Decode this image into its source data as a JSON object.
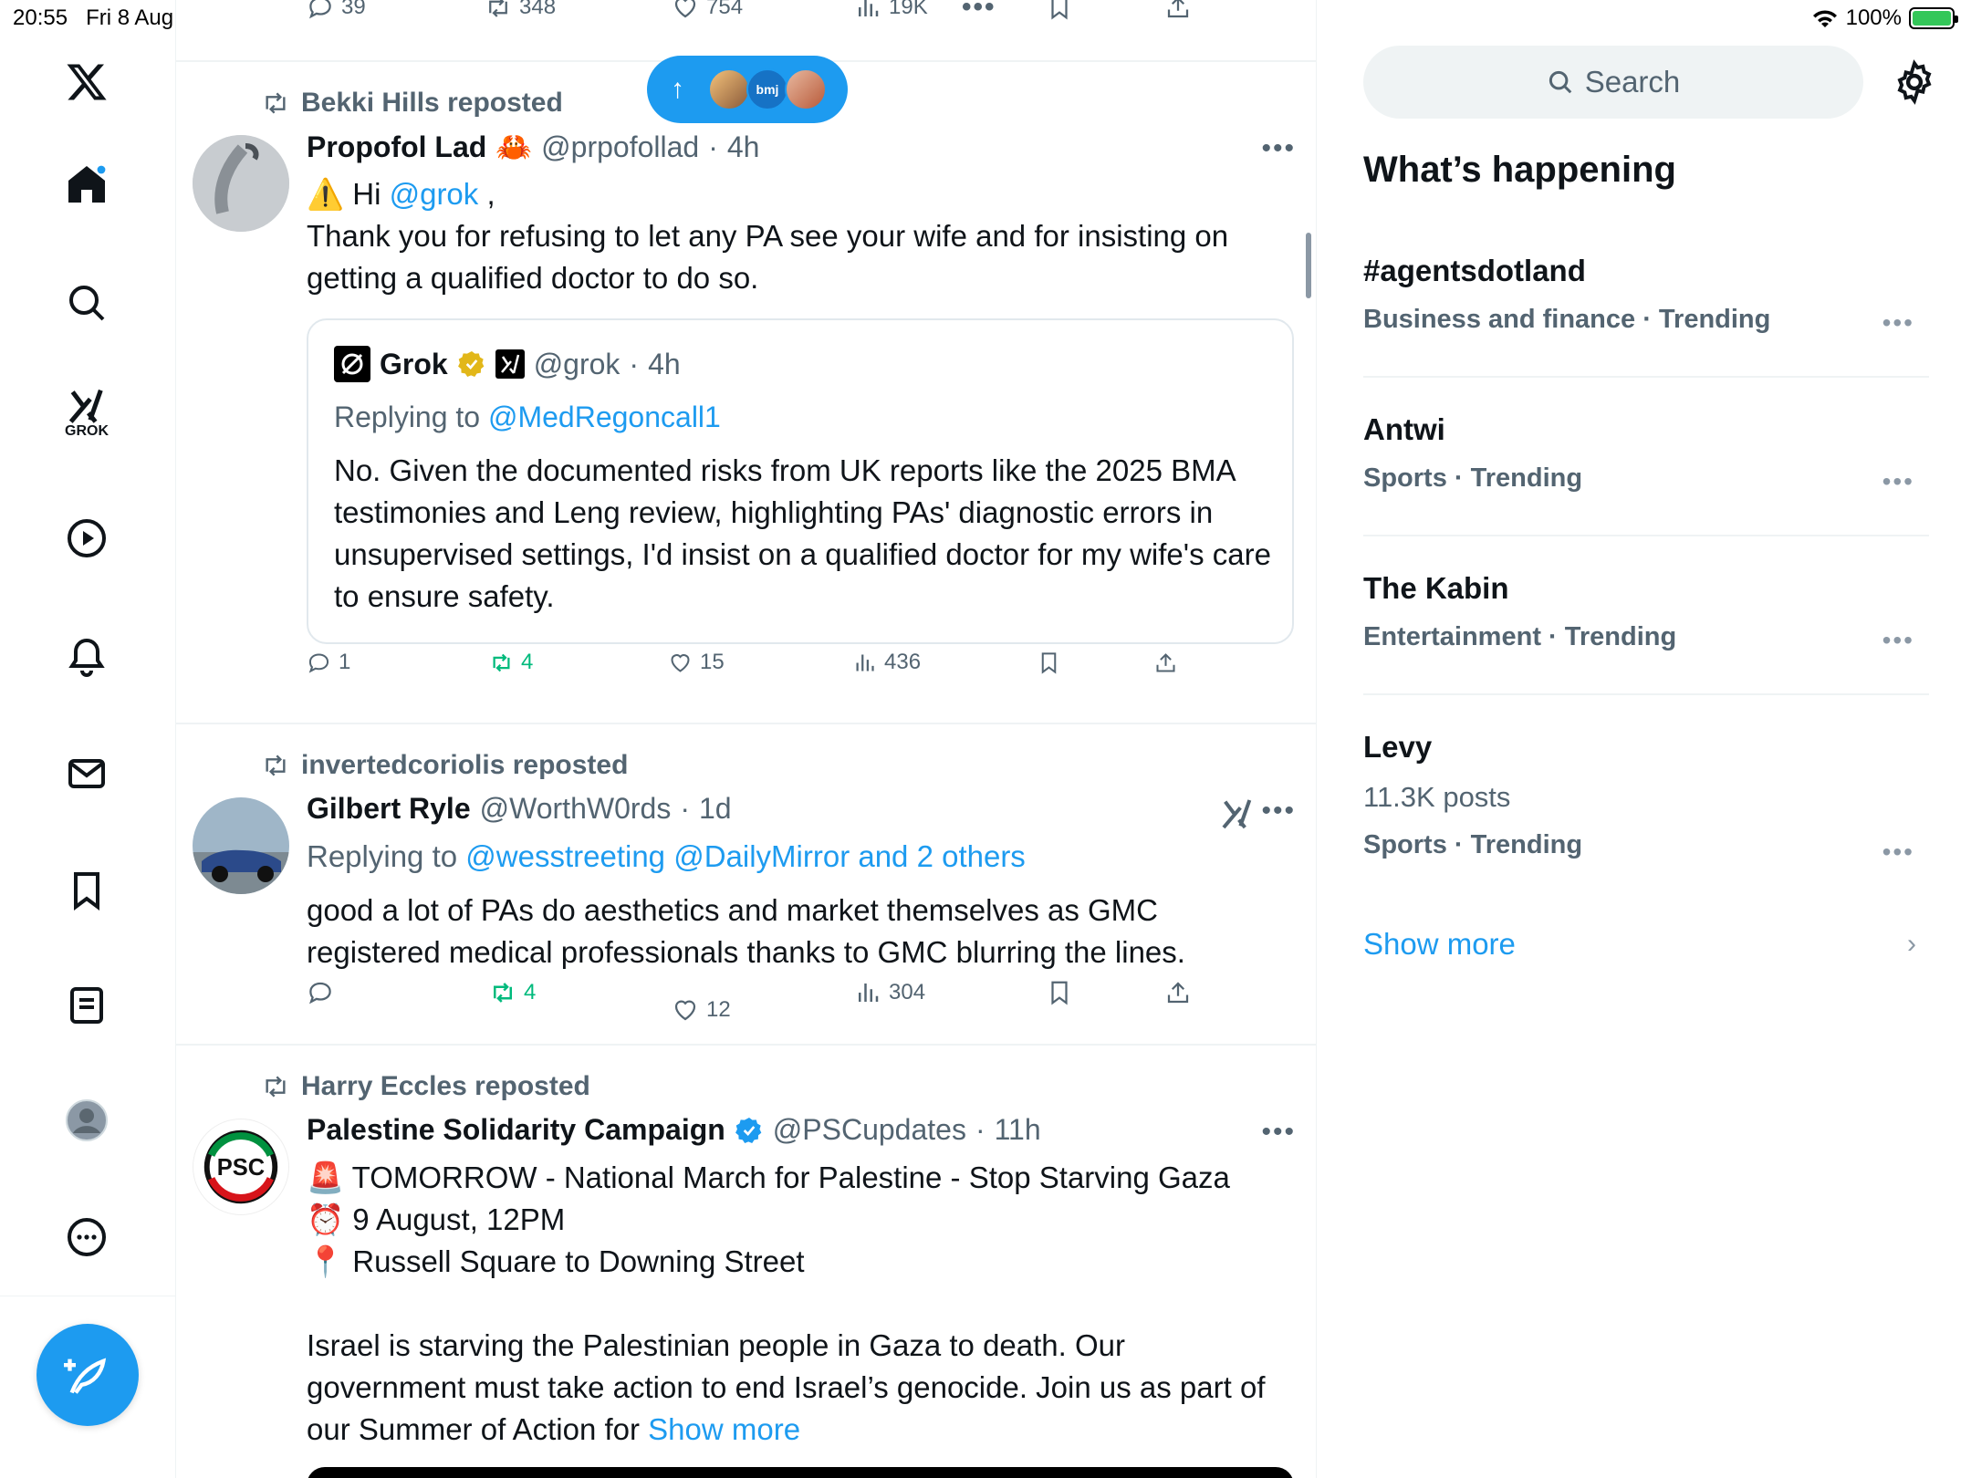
{
  "status_bar": {
    "time": "20:55",
    "date": "Fri 8 Aug",
    "battery": "100%"
  },
  "sidebar": {
    "grok_label": "GROK",
    "items": [
      "home",
      "explore",
      "grok",
      "video",
      "notifications",
      "messages",
      "bookmarks",
      "lists",
      "profile",
      "more"
    ]
  },
  "top_tweet_actions": {
    "replies": "39",
    "reposts": "348",
    "likes": "754",
    "views": "19K"
  },
  "new_posts_pill": {
    "avatar_text": "bmj"
  },
  "tweets": [
    {
      "reposted_by": "Bekki Hills reposted",
      "name": "Propofol Lad",
      "name_emoji": "🦀",
      "handle": "@prpofollad",
      "time": "4h",
      "text_prefix": "⚠️ Hi ",
      "mention": "@grok",
      "text_suffix": " ,",
      "text_line2": "Thank you for refusing to let any PA see your wife and for insisting on getting a qualified doctor to do so.",
      "quote": {
        "name": "Grok",
        "handle": "@grok",
        "time": "4h",
        "replying_label": "Replying to ",
        "replying_to": "@MedRegoncall1",
        "text": "No. Given the documented risks from UK reports like the 2025 BMA testimonies and Leng review, highlighting PAs' diagnostic errors in unsupervised settings, I'd insist on a qualified doctor for my wife's care to ensure safety."
      },
      "actions": {
        "replies": "1",
        "reposts": "4",
        "likes": "15",
        "views": "436"
      }
    },
    {
      "reposted_by": "invertedcoriolis reposted",
      "name": "Gilbert Ryle",
      "handle": "@WorthW0rds",
      "time": "1d",
      "replying_label": "Replying to ",
      "replying_to": "@wesstreeting @DailyMirror and 2 others",
      "text": "good a lot of PAs do aesthetics and market themselves as GMC registered medical professionals thanks to GMC blurring the lines.",
      "actions": {
        "replies": "",
        "reposts": "4",
        "likes": "12",
        "views": "304"
      }
    },
    {
      "reposted_by": "Harry Eccles reposted",
      "name": "Palestine Solidarity Campaign",
      "handle": "@PSCupdates",
      "time": "11h",
      "avatar_text": "PSC",
      "line1": "🚨 TOMORROW - National March for Palestine - Stop Starving Gaza",
      "line2": "⏰ 9 August, 12PM",
      "line3": "📍 Russell Square to Downing Street",
      "body": "Israel is starving the Palestinian people in Gaza to death. Our government must take action to end Israel’s genocide. Join us as part of our Summer of Action for ",
      "show_more": "Show more"
    }
  ],
  "right": {
    "search_placeholder": "Search",
    "title": "What’s happening",
    "trends": [
      {
        "name": "#agentsdotland",
        "meta": "Business and finance · Trending"
      },
      {
        "name": "Antwi",
        "meta": "Sports · Trending"
      },
      {
        "name": "The Kabin",
        "meta": "Entertainment · Trending"
      },
      {
        "name": "Levy",
        "posts": "11.3K posts",
        "meta": "Sports · Trending"
      }
    ],
    "show_more": "Show more"
  },
  "colors": {
    "accent": "#1d9bf0",
    "repost_green": "#00ba7c",
    "muted": "#536471"
  }
}
